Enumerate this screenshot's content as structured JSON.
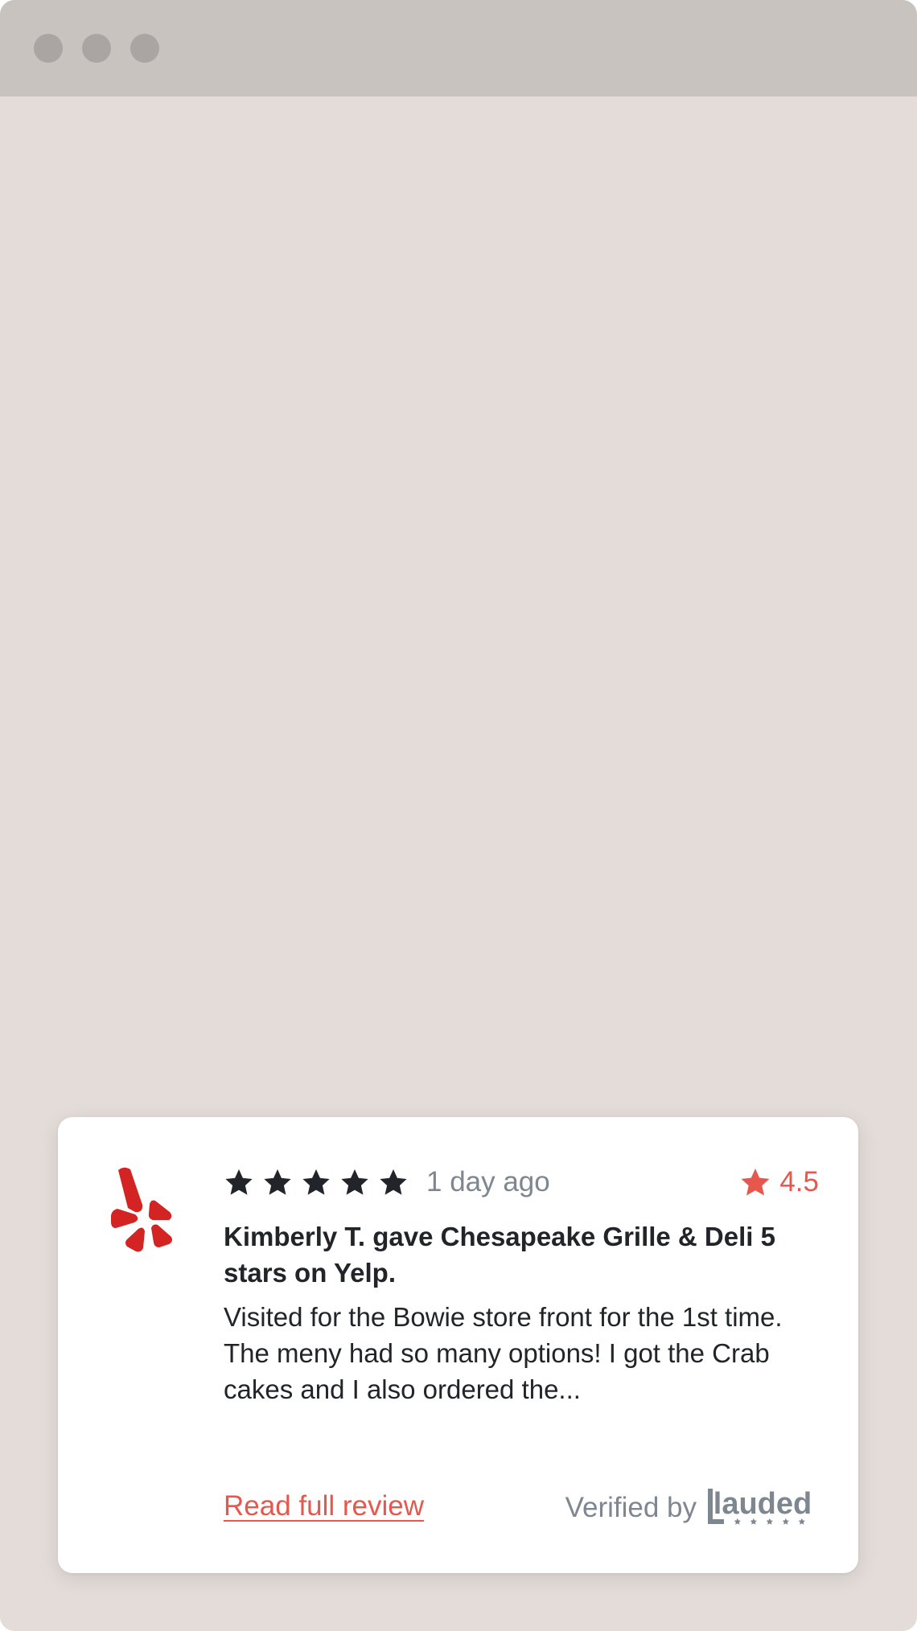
{
  "window": {
    "controls": [
      "close",
      "minimize",
      "maximize"
    ]
  },
  "review": {
    "source_icon": "yelp-logo-icon",
    "source_color": "#d32323",
    "star_rating": 5,
    "max_stars": 5,
    "time_ago": "1 day ago",
    "average_rating": "4.5",
    "title": "Kimberly T. gave Chesapeake Grille & Deli 5 stars on Yelp.",
    "body": "Visited for the Bowie store front for the 1st time.  The meny had so many options! I got the Crab cakes and I also ordered the...",
    "read_more_label": "Read full review",
    "verified_label": "Verified by",
    "verified_brand": "lauded"
  },
  "colors": {
    "accent": "#e6584d",
    "muted_text": "#7e8790",
    "text": "#212529",
    "background": "#e3dcd8",
    "titlebar": "#c8c3bf"
  }
}
